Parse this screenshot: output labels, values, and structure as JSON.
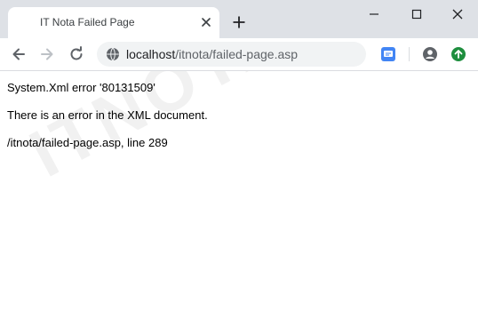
{
  "browser": {
    "tab": {
      "title": "IT Nota Failed Page"
    },
    "address_bar": {
      "host": "localhost",
      "path": "/itnota/failed-page.asp"
    }
  },
  "page": {
    "lines": [
      "System.Xml error '80131509'",
      "There is an error in the XML document.",
      "/itnota/failed-page.asp, line 289"
    ]
  },
  "watermark": "ITNOTA.COM",
  "colors": {
    "titlebar": "#dee1e6",
    "omnibox": "#f1f3f4",
    "extension_blue": "#4285f4",
    "update_green": "#1e8e3e"
  },
  "icons": [
    "close-icon",
    "plus-icon",
    "minimize-icon",
    "maximize-icon",
    "back-arrow-icon",
    "forward-arrow-icon",
    "reload-icon",
    "globe-icon",
    "extension-icon",
    "account-icon",
    "update-icon"
  ]
}
